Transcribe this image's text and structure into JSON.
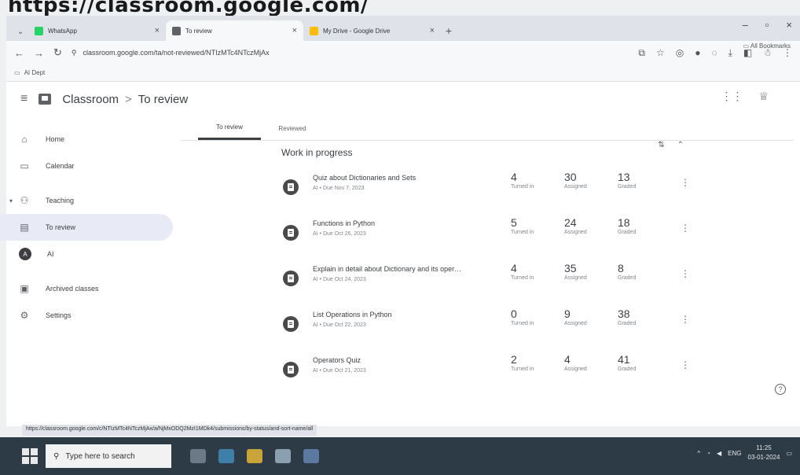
{
  "caption": "https://classroom.google.com/",
  "browser": {
    "tabs": [
      {
        "title": "WhatsApp",
        "favicon_color": "#25d366",
        "active": false
      },
      {
        "title": "To review",
        "favicon_color": "#5f6368",
        "active": true
      },
      {
        "title": "My Drive - Google Drive",
        "favicon_color": "#fbbc04",
        "active": false
      }
    ],
    "url": "classroom.google.com/ta/not-reviewed/NTIzMTc4NTczMjAx",
    "all_bookmarks": "All Bookmarks",
    "bookmark_folder": "AI Dept"
  },
  "app": {
    "title": "Classroom",
    "breadcrumb_sep": ">",
    "page": "To review"
  },
  "sidebar": {
    "items": [
      {
        "label": "Home",
        "icon": "home-icon",
        "glyph": "⌂"
      },
      {
        "label": "Calendar",
        "icon": "calendar-icon",
        "glyph": "▭"
      },
      {
        "label": "Teaching",
        "icon": "people-icon",
        "glyph": "👥"
      },
      {
        "label": "To review",
        "icon": "folder-icon",
        "glyph": "▤"
      },
      {
        "label": "AI",
        "icon": "avatar",
        "glyph": "A"
      },
      {
        "label": "Archived classes",
        "icon": "archive-icon",
        "glyph": "▣"
      },
      {
        "label": "Settings",
        "icon": "gear-icon",
        "glyph": "⚙"
      }
    ]
  },
  "main": {
    "tabs": [
      "To review",
      "Reviewed"
    ],
    "section": "Work in progress",
    "assignments": [
      {
        "title": "Quiz about Dictionaries and Sets",
        "due": "AI • Due Nov 7, 2023",
        "turned_in": "4",
        "assigned": "30",
        "graded": "13"
      },
      {
        "title": "Functions in Python",
        "due": "AI • Due Oct 26, 2023",
        "turned_in": "5",
        "assigned": "24",
        "graded": "18"
      },
      {
        "title": "Explain in detail about Dictionary and its oper…",
        "due": "AI • Due Oct 24, 2023",
        "turned_in": "4",
        "assigned": "35",
        "graded": "8"
      },
      {
        "title": "List Operations in Python",
        "due": "AI • Due Oct 22, 2023",
        "turned_in": "0",
        "assigned": "9",
        "graded": "38"
      },
      {
        "title": "Operators Quiz",
        "due": "AI • Due Oct 21, 2023",
        "turned_in": "2",
        "assigned": "4",
        "graded": "41"
      }
    ],
    "labels": {
      "turned_in": "Turned in",
      "assigned": "Assigned",
      "graded": "Graded"
    }
  },
  "status_url": "https://classroom.google.com/c/NTIzMTc4NTczMjAx/a/NjMxODQ2MzI1MDk4/submissions/by-status/and-sort-name/all",
  "taskbar": {
    "search_placeholder": "Type here to search",
    "lang": "ENG",
    "time": "11:25",
    "date": "03-01-2024"
  },
  "colors": {
    "accent": "#3c4043",
    "tab_strip": "#dfe3e9",
    "taskbar": "#2d3b47"
  }
}
